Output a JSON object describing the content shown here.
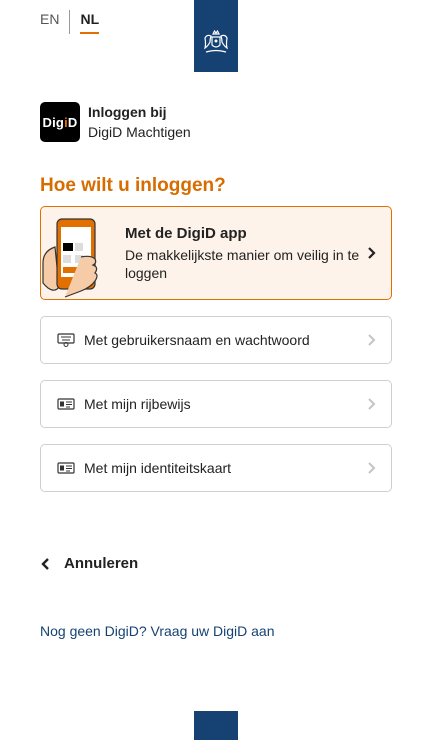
{
  "language": {
    "en_label": "EN",
    "nl_label": "NL",
    "active": "NL"
  },
  "service": {
    "logo_text_prefix": "Dig",
    "logo_text_accent": "i",
    "logo_text_suffix": "D",
    "title": "Inloggen bij",
    "subtitle": "DigiD Machtigen"
  },
  "heading": "Hoe wilt u inloggen?",
  "options": {
    "app": {
      "title": "Met de DigiD app",
      "subtitle": "De makkelijkste manier om veilig in te loggen",
      "icon": "phone-hand-icon"
    },
    "password": {
      "label": "Met gebruikersnaam en wachtwoord",
      "icon": "password-keyboard-icon"
    },
    "license": {
      "label": "Met mijn rijbewijs",
      "icon": "id-card-icon"
    },
    "idcard": {
      "label": "Met mijn identiteitskaart",
      "icon": "id-card-icon"
    }
  },
  "cancel_label": "Annuleren",
  "signup_link": "Nog geen DigiD? Vraag uw DigiD aan",
  "colors": {
    "accent": "#e17000",
    "heading": "#d76d00",
    "rijksoverheid_blue": "#154273",
    "primary_bg": "#fdf3ea"
  }
}
